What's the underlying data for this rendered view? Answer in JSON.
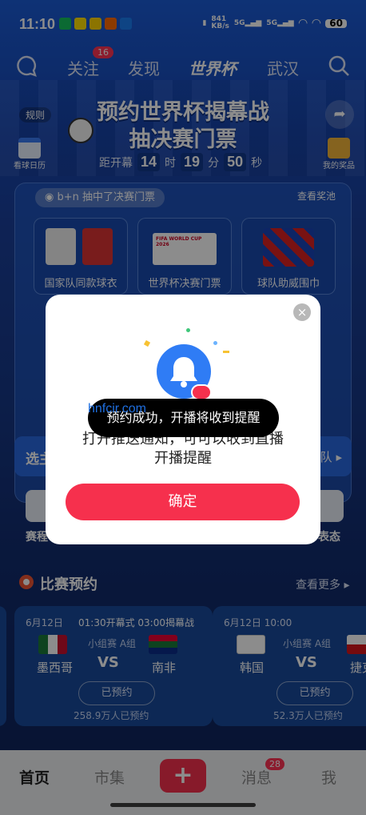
{
  "status": {
    "time": "11:10",
    "speed_top": "841",
    "speed_bottom": "KB/s",
    "net1": "5G",
    "net2": "5G",
    "battery": "60"
  },
  "nav": {
    "follow": "关注",
    "follow_badge": "16",
    "discover": "发现",
    "worldcup": "世界杯",
    "city": "武汉"
  },
  "banner": {
    "rules": "规则",
    "title1": "预约世界杯揭幕战",
    "title2": "抽决赛门票",
    "calendar": "看球日历",
    "my_prizes": "我的奖品",
    "count_prefix": "距开幕",
    "days": "14",
    "day_unit": "时",
    "hours": "19",
    "hour_unit": "分",
    "minutes": "50",
    "minute_unit": "秒"
  },
  "pool": {
    "ticker": "b+n 抽中了决赛门票",
    "view": "查看奖池",
    "prizes": [
      "国家队同款球衣",
      "世界杯决赛门票",
      "球队助威围巾"
    ],
    "ticket_small": "FIFA WORLD CUP 2026"
  },
  "bar": {
    "left": "选主",
    "right": "队"
  },
  "features": {
    "left": "赛程",
    "right": "表态"
  },
  "matches": {
    "title": "比赛预约",
    "more": "查看更多",
    "items": [
      {
        "date": "6月12日",
        "time": "01:30开幕式 03:00揭幕战",
        "group": "小组赛 A组",
        "home": "墨西哥",
        "away": "南非",
        "vs": "VS",
        "btn": "已预约",
        "count": "258.9万人已预约"
      },
      {
        "date": "6月12日 10:00",
        "time": "",
        "group": "小组赛 A组",
        "home": "韩国",
        "away": "捷克",
        "vs": "VS",
        "btn": "已预约",
        "count": "52.3万人已预约"
      }
    ]
  },
  "tabbar": {
    "home": "首页",
    "market": "市集",
    "plus": "+",
    "messages": "消息",
    "messages_badge": "28",
    "me": "我"
  },
  "dialog": {
    "close": "×",
    "line1": "打开推送通知，可可以收到直播",
    "line2": "开播提醒",
    "confirm": "确定"
  },
  "toast": {
    "text": "预约成功，开播将收到提醒"
  },
  "watermark": {
    "text": "hnfcir.com"
  },
  "colors": {
    "accent": "#f6304d",
    "bell": "#2f7cf5",
    "badge": "#ff3355"
  }
}
